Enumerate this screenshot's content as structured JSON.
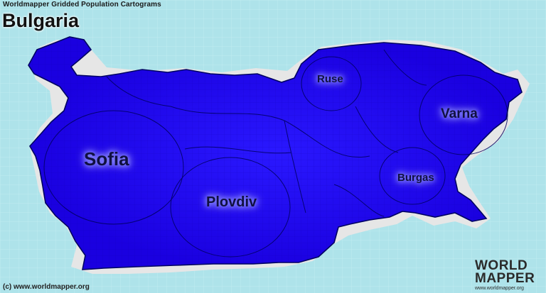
{
  "series_title": "Worldmapper Gridded Population Cartograms",
  "country": "Bulgaria",
  "cities": [
    {
      "name": "Sofia"
    },
    {
      "name": "Plovdiv"
    },
    {
      "name": "Ruse"
    },
    {
      "name": "Varna"
    },
    {
      "name": "Burgas"
    }
  ],
  "copyright": "(c) www.worldmapper.org",
  "logo": {
    "line1": "WORLD",
    "line2": "MAPPER",
    "url": "www.worldmapper.org"
  },
  "colors": {
    "sea": "#aee3ea",
    "land": "#1e00f0",
    "shadow": "#e6e6e6",
    "grid": "#c6eef2",
    "outline": "#000060"
  }
}
